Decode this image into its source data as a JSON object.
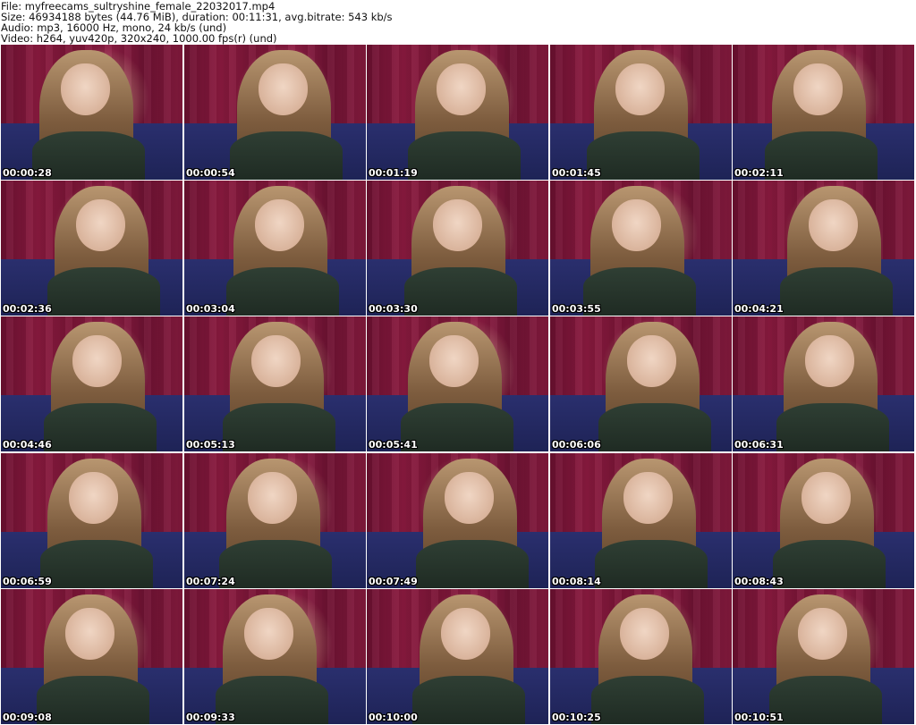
{
  "header": {
    "line1": "File: myfreecams_sultryshine_female_22032017.mp4",
    "line2": "Size: 46934188 bytes (44.76 MiB), duration: 00:11:31, avg.bitrate: 543 kb/s",
    "line3": "Audio: mp3, 16000 Hz, mono, 24 kb/s (und)",
    "line4": "Video: h264, yuv420p, 320x240, 1000.00 fps(r) (und)"
  },
  "thumbnails": [
    "00:00:28",
    "00:00:54",
    "00:01:19",
    "00:01:45",
    "00:02:11",
    "00:02:36",
    "00:03:04",
    "00:03:30",
    "00:03:55",
    "00:04:21",
    "00:04:46",
    "00:05:13",
    "00:05:41",
    "00:06:06",
    "00:06:31",
    "00:06:59",
    "00:07:24",
    "00:07:49",
    "00:08:14",
    "00:08:43",
    "00:09:08",
    "00:09:33",
    "00:10:00",
    "00:10:25",
    "00:10:51"
  ]
}
